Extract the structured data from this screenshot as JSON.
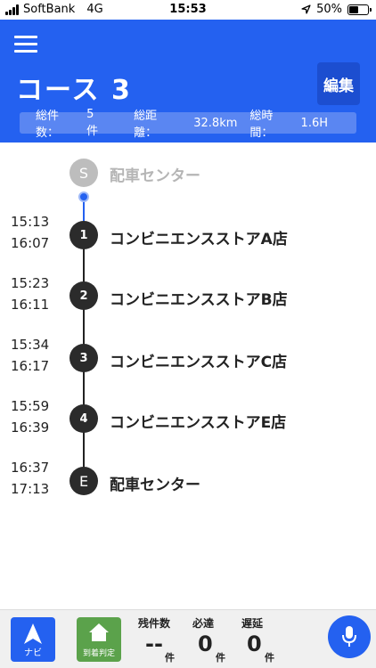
{
  "status_bar": {
    "carrier": "SoftBank",
    "network": "4G",
    "time": "15:53",
    "battery": "50%"
  },
  "header": {
    "title": "コース 3",
    "edit_label": "編集",
    "summary": {
      "count_label": "総件数：",
      "count_value": "5件",
      "distance_label": "総距離：",
      "distance_value": "32.8km",
      "time_label": "総時間：",
      "time_value": "1.6H"
    }
  },
  "stops": [
    {
      "marker": "S",
      "name": "配車センター"
    },
    {
      "marker": "1",
      "name": "コンビニエンスストアA店",
      "arrive": "15:13",
      "depart": "16:07"
    },
    {
      "marker": "2",
      "name": "コンビニエンスストアB店",
      "arrive": "15:23",
      "depart": "16:11"
    },
    {
      "marker": "3",
      "name": "コンビニエンスストアC店",
      "arrive": "15:34",
      "depart": "16:17"
    },
    {
      "marker": "4",
      "name": "コンビニエンスストアE店",
      "arrive": "15:59",
      "depart": "16:39"
    },
    {
      "marker": "E",
      "name": "配車センター",
      "arrive": "16:37",
      "depart": "17:13"
    }
  ],
  "bottom_bar": {
    "navi_label": "ナビ",
    "arrival_label": "到着判定",
    "remaining_label": "残件数",
    "remaining_value": "--",
    "required_label": "必達",
    "required_value": "0",
    "delay_label": "遅延",
    "delay_value": "0",
    "unit": "件"
  },
  "colors": {
    "accent": "#2461f0",
    "arrival_green": "#5ba24b",
    "node_dark": "#2b2b2b",
    "node_start": "#bdbdbd"
  },
  "icons": {
    "menu": "hamburger-icon",
    "navi": "navigation-arrow-icon",
    "arrival": "home-icon",
    "mic": "microphone-icon"
  }
}
